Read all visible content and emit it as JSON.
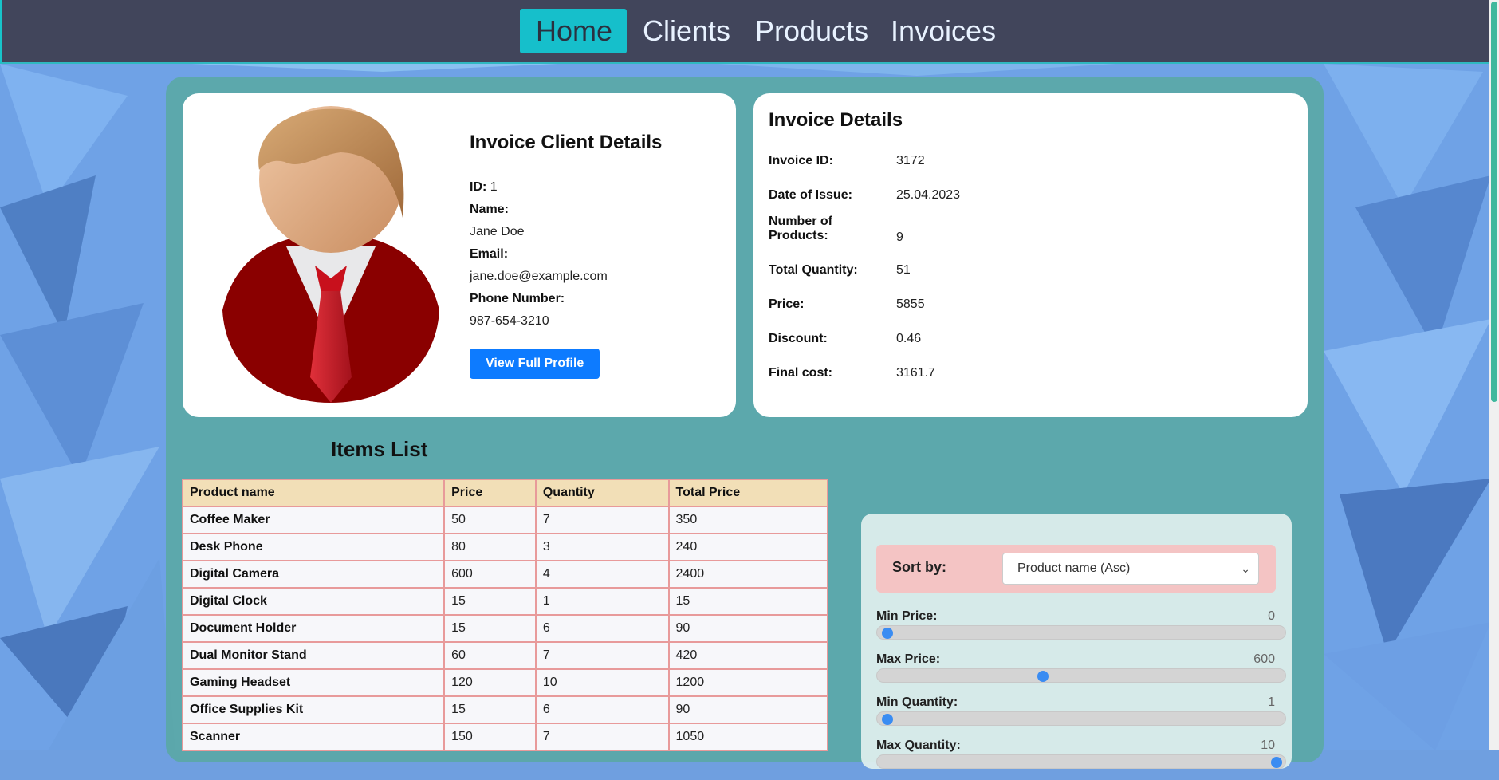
{
  "nav": {
    "items": [
      {
        "label": "Home",
        "active": true
      },
      {
        "label": "Clients",
        "active": false
      },
      {
        "label": "Products",
        "active": false
      },
      {
        "label": "Invoices",
        "active": false
      }
    ]
  },
  "client": {
    "title": "Invoice Client Details",
    "id_label": "ID:",
    "id_value": "1",
    "name_label": "Name:",
    "name_value": "Jane Doe",
    "email_label": "Email:",
    "email_value": "jane.doe@example.com",
    "phone_label": "Phone Number:",
    "phone_value": "987-654-3210",
    "profile_button": "View Full Profile"
  },
  "invoice": {
    "title": "Invoice Details",
    "rows": [
      {
        "label": "Invoice ID:",
        "value": "3172"
      },
      {
        "label": "Date of Issue:",
        "value": "25.04.2023"
      },
      {
        "label": "Number of Products:",
        "value": "9"
      },
      {
        "label": "Total Quantity:",
        "value": "51"
      },
      {
        "label": "Price:",
        "value": "5855"
      },
      {
        "label": "Discount:",
        "value": "0.46"
      },
      {
        "label": "Final cost:",
        "value": "3161.7"
      }
    ]
  },
  "items": {
    "title": "Items List",
    "columns": [
      "Product name",
      "Price",
      "Quantity",
      "Total Price"
    ],
    "rows": [
      [
        "Coffee Maker",
        "50",
        "7",
        "350"
      ],
      [
        "Desk Phone",
        "80",
        "3",
        "240"
      ],
      [
        "Digital Camera",
        "600",
        "4",
        "2400"
      ],
      [
        "Digital Clock",
        "15",
        "1",
        "15"
      ],
      [
        "Document Holder",
        "15",
        "6",
        "90"
      ],
      [
        "Dual Monitor Stand",
        "60",
        "7",
        "420"
      ],
      [
        "Gaming Headset",
        "120",
        "10",
        "1200"
      ],
      [
        "Office Supplies Kit",
        "15",
        "6",
        "90"
      ],
      [
        "Scanner",
        "150",
        "7",
        "1050"
      ]
    ]
  },
  "filters": {
    "sort_label": "Sort by:",
    "sort_value": "Product name (Asc)",
    "ranges": [
      {
        "label": "Min Price:",
        "value": "0",
        "fraction": 0.0
      },
      {
        "label": "Max Price:",
        "value": "600",
        "fraction": 0.4
      },
      {
        "label": "Min Quantity:",
        "value": "1",
        "fraction": 0.0
      },
      {
        "label": "Max Quantity:",
        "value": "10",
        "fraction": 1.0
      }
    ]
  },
  "colors": {
    "accent": "#16bfcb",
    "navbar": "#41455b",
    "button": "#0d7bff"
  }
}
